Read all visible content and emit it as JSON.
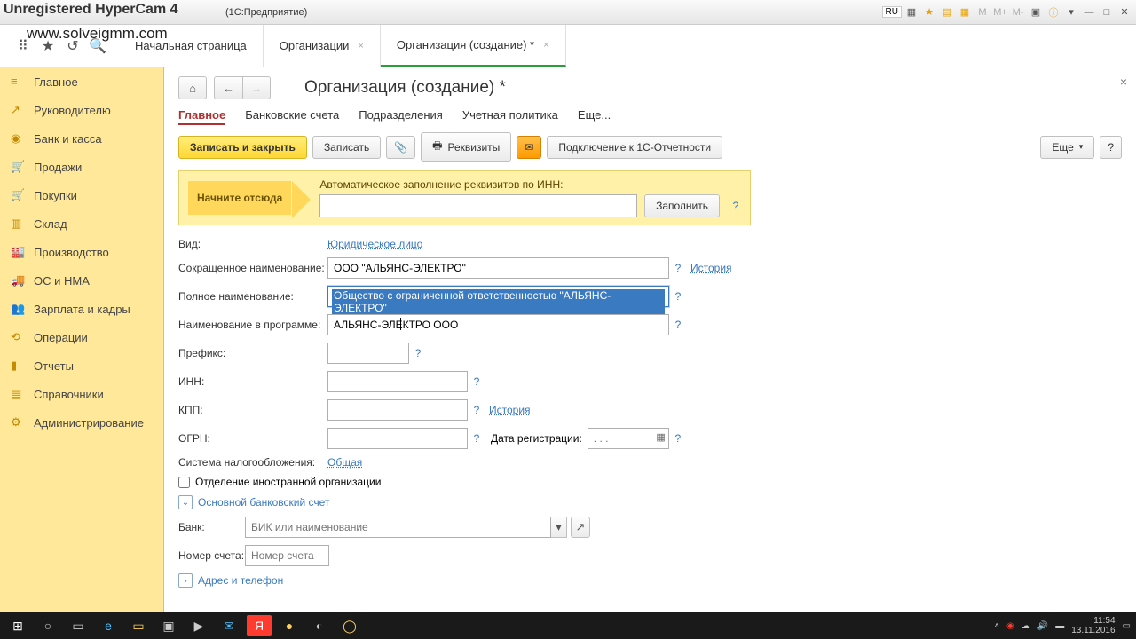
{
  "window": {
    "title": "(1С:Предприятие)",
    "lang": "RU"
  },
  "watermark": {
    "line1": "Unregistered HyperCam 4",
    "line2": "www.solveigmm.com"
  },
  "tabs": [
    {
      "label": "Начальная страница",
      "closable": false
    },
    {
      "label": "Организации",
      "closable": true
    },
    {
      "label": "Организация (создание) *",
      "closable": true,
      "active": true
    }
  ],
  "sidebar": {
    "items": [
      {
        "label": "Главное",
        "icon": "home"
      },
      {
        "label": "Руководителю",
        "icon": "chart"
      },
      {
        "label": "Банк и касса",
        "icon": "bank"
      },
      {
        "label": "Продажи",
        "icon": "cart"
      },
      {
        "label": "Покупки",
        "icon": "cart-in"
      },
      {
        "label": "Склад",
        "icon": "warehouse"
      },
      {
        "label": "Производство",
        "icon": "factory"
      },
      {
        "label": "ОС и НМА",
        "icon": "truck"
      },
      {
        "label": "Зарплата и кадры",
        "icon": "people"
      },
      {
        "label": "Операции",
        "icon": "ops"
      },
      {
        "label": "Отчеты",
        "icon": "report"
      },
      {
        "label": "Справочники",
        "icon": "book"
      },
      {
        "label": "Администрирование",
        "icon": "gear"
      }
    ]
  },
  "page": {
    "title": "Организация (создание) *",
    "subtabs": [
      "Главное",
      "Банковские счета",
      "Подразделения",
      "Учетная политика",
      "Еще..."
    ],
    "toolbar": {
      "save_close": "Записать и закрыть",
      "save": "Записать",
      "requisites": "Реквизиты",
      "connect1c": "Подключение к 1С-Отчетности",
      "more": "Еще"
    },
    "autofill": {
      "start_here": "Начните отсюда",
      "label": "Автоматическое заполнение реквизитов по ИНН:",
      "fill_btn": "Заполнить"
    },
    "fields": {
      "vid_label": "Вид:",
      "vid_value": "Юридическое лицо",
      "short_label": "Сокращенное наименование:",
      "short_value": "ООО \"АЛЬЯНС-ЭЛЕКТРО\"",
      "full_label": "Полное наименование:",
      "full_value": "Общество с ограниченной ответственностью \"АЛЬЯНС-ЭЛЕКТРО\"",
      "prog_label": "Наименование в программе:",
      "prog_value": "АЛЬЯНС-ЭЛЕКТРО ООО",
      "prefix_label": "Префикс:",
      "inn_label": "ИНН:",
      "kpp_label": "КПП:",
      "ogrn_label": "ОГРН:",
      "reg_date_label": "Дата регистрации:",
      "reg_date_placeholder": ". . .",
      "tax_label": "Система налогообложения:",
      "tax_value": "Общая",
      "history": "История",
      "foreign_branch": "Отделение иностранной организации",
      "bank_section": "Основной банковский счет",
      "bank_label": "Банк:",
      "bank_placeholder": "БИК или наименование",
      "account_label": "Номер счета:",
      "account_placeholder": "Номер счета",
      "address_section": "Адрес и телефон"
    }
  },
  "taskbar": {
    "time": "11:54",
    "date": "13.11.2016"
  }
}
